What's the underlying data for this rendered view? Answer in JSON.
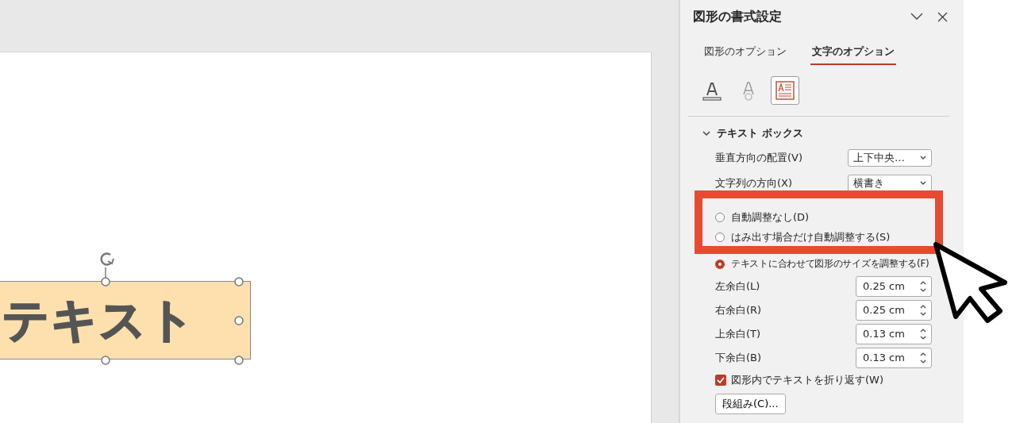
{
  "slide": {
    "shape_text": "テキスト",
    "selected": true
  },
  "panel": {
    "title": "図形の書式設定",
    "tabs": [
      {
        "label": "図形のオプション",
        "selected": false
      },
      {
        "label": "文字のオプション",
        "selected": true
      }
    ],
    "icon_tabs": [
      {
        "kind": "fill",
        "selected": false
      },
      {
        "kind": "effects",
        "selected": false
      },
      {
        "kind": "textbox",
        "selected": true
      }
    ],
    "section": {
      "title": "テキスト ボックス",
      "expanded": true
    },
    "dropdowns": [
      {
        "label": "垂直方向の配置(V)",
        "value": "上下中央…"
      },
      {
        "label": "文字列の方向(X)",
        "value": "横書き"
      }
    ],
    "radios": [
      {
        "label": "自動調整なし(D)",
        "selected": false
      },
      {
        "label": "はみ出す場合だけ自動調整する(S)",
        "selected": false
      },
      {
        "label": "テキストに合わせて図形のサイズを調整する(F)",
        "selected": true
      }
    ],
    "margins": [
      {
        "label": "左余白(L)",
        "value": "0.25 cm"
      },
      {
        "label": "右余白(R)",
        "value": "0.25 cm"
      },
      {
        "label": "上余白(T)",
        "value": "0.13 cm"
      },
      {
        "label": "下余白(B)",
        "value": "0.13 cm"
      }
    ],
    "wrap": {
      "label": "図形内でテキストを折り返す(W)",
      "checked": true
    },
    "columns_button": "段組み(C)..."
  }
}
